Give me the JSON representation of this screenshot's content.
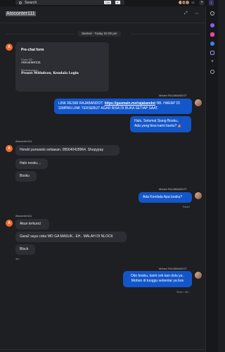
{
  "topbar": {
    "search_label": "Search",
    "shortcut_ctrl": "Ctrl",
    "shortcut_key": "K",
    "participants_count": "13",
    "plus_label": "+",
    "account_initial": "I"
  },
  "header": {
    "title": "Atoconter111"
  },
  "conversation": {
    "started_label": "Started - Today 02:00 pm",
    "prechat": {
      "title": "Pre-chat form",
      "user_id_label": "User ID :",
      "user_id_value": "Atoconter111",
      "question_label": "Pertanyaan:",
      "question_value": "Proses Withdraw, Kendala Login"
    },
    "agent_name": "Melani RAJABANDOT",
    "customer_name": "Atoconter111",
    "msg1_pre": "LINK RESMI RAJABANDOT: ",
    "msg1_link": "https://gasmain.me/rajabandot",
    "msg1_post": " NB. HARAP DI SIMPAN LINK TERSEBUT AGAR BISA DI BUKA SETIAP SAAT.",
    "msg2_line1": "Halo, Selamat Siang Bosku..",
    "msg2_line2": "Ada yang bisa kami bantu?",
    "msg3": "Hendri purwanto setiawan. 085640428964. Shopypay",
    "msg4": "Halo nosku....",
    "msg5": "Bosku",
    "msg6": "Ada Kendala Apa bosku?",
    "read_label": "Read",
    "msg7": "Akun terkunci",
    "msg8": "Gara2 saya coba WD GA MASUK.. EH.. MALAH DI NLOCK",
    "msg9": "Block",
    "time_3m": "3m",
    "msg10_line1": "Oke bosku, kami cek kan dulu ya..",
    "msg10_line2": "Mohon di tunggu sebentar ya bos",
    "sent_label": "Sent • 3m",
    "avatar_initial": "A"
  },
  "colors": {
    "accent_blue": "#1356c9",
    "avatar_orange": "#f36b2a"
  }
}
